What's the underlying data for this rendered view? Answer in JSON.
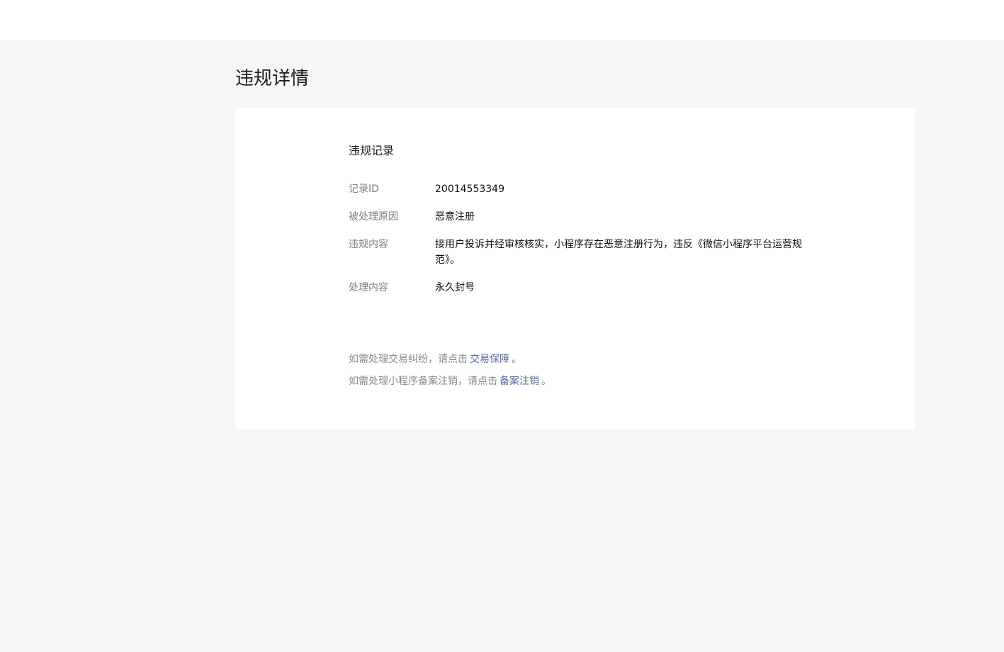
{
  "page": {
    "title": "违规详情"
  },
  "card": {
    "section_title": "违规记录",
    "rows": [
      {
        "label": "记录ID",
        "value": "20014553349"
      },
      {
        "label": "被处理原因",
        "value": "恶意注册"
      },
      {
        "label": "违规内容",
        "value": "接用户投诉并经审核核实，小程序存在恶意注册行为，违反《微信小程序平台运营规范》。"
      },
      {
        "label": "处理内容",
        "value": "永久封号"
      }
    ],
    "notes": [
      {
        "prefix": "如需处理交易纠纷，请点击",
        "link": "交易保障",
        "suffix": "。"
      },
      {
        "prefix": "如需处理小程序备案注销，请点击",
        "link": "备案注销",
        "suffix": "。"
      }
    ]
  },
  "colors": {
    "background": "#f5f6f7",
    "card": "#ffffff",
    "link": "#576b95",
    "label": "#7e7e7e"
  }
}
